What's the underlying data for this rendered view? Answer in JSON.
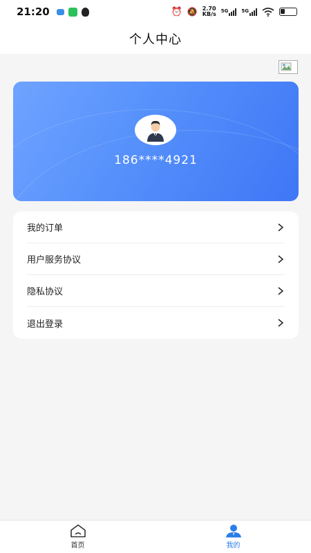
{
  "status_bar": {
    "time": "21:20",
    "net_speed": "2.70\nKB/s",
    "net_speed_top": "2.70",
    "net_speed_bottom": "KB/s",
    "sig1_label": "5G",
    "sig2_label": "5G"
  },
  "header": {
    "title": "个人中心"
  },
  "profile": {
    "phone": "186****4921"
  },
  "menu": {
    "items": [
      {
        "label": "我的订单"
      },
      {
        "label": "用户服务协议"
      },
      {
        "label": "隐私协议"
      },
      {
        "label": "退出登录"
      }
    ]
  },
  "tabbar": {
    "home_label": "首页",
    "mine_label": "我的",
    "active_color": "#2b7de9"
  },
  "colors": {
    "card_gradient_start": "#6fa3ff",
    "card_gradient_end": "#3f76f6",
    "background": "#f5f5f5"
  }
}
